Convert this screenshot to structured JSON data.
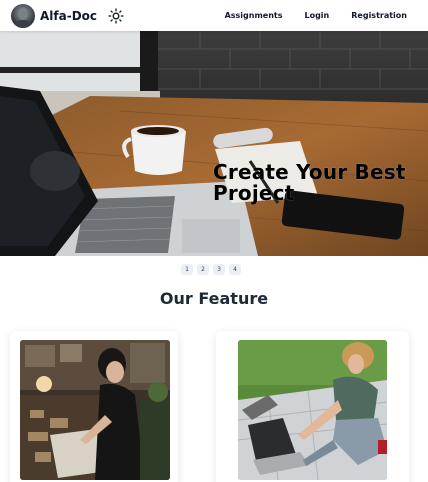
{
  "header": {
    "brand": "Alfa-Doc",
    "nav": [
      {
        "label": "Assignments"
      },
      {
        "label": "Login"
      },
      {
        "label": "Registration"
      }
    ]
  },
  "hero": {
    "title": "Create Your Best\nProject"
  },
  "pagination": {
    "pages": [
      "1",
      "2",
      "3",
      "4"
    ]
  },
  "features": {
    "title": "Our Feature"
  }
}
